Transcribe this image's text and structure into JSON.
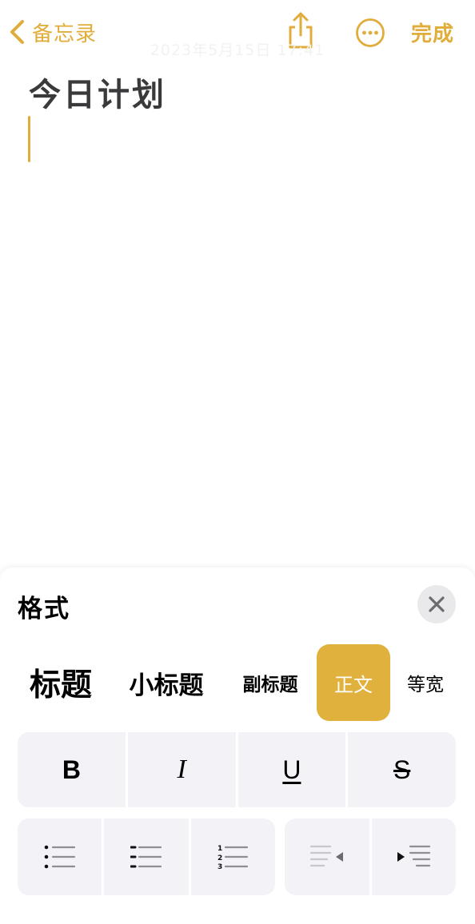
{
  "nav": {
    "back_label": "备忘录",
    "done_label": "完成",
    "date": "2023年5月15日 17:41"
  },
  "note": {
    "title": "今日计划"
  },
  "format_panel": {
    "title": "格式",
    "styles": {
      "title": "标题",
      "heading": "小标题",
      "subheading": "副标题",
      "body": "正文",
      "monospaced": "等宽"
    },
    "selected_style": "正文",
    "text_styles": {
      "bold": "B",
      "italic": "I",
      "underline": "U",
      "strikethrough": "S"
    },
    "list_tools": [
      "dashed-list-icon",
      "bulleted-list-icon",
      "numbered-list-icon"
    ],
    "indent_tools": [
      "decrease-indent-icon",
      "increase-indent-icon"
    ]
  },
  "colors": {
    "accent": "#e0ad3b",
    "selected_style_bg": "#e0b13c",
    "button_group_bg": "#f2f2f7",
    "close_button_bg": "#e9e9eb"
  }
}
